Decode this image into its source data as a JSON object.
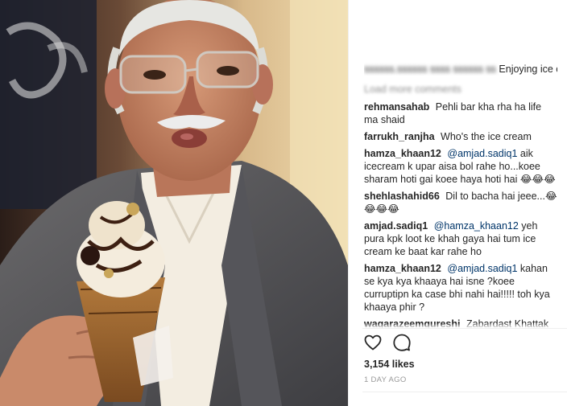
{
  "post": {
    "caption_user": "ssssss.ssssss",
    "caption_text_blurred": "ssss ssssss ss",
    "caption_text": "Enjoying ice cream",
    "load_more": "Load more comments",
    "likes": "3,154 likes",
    "time": "1 DAY AGO"
  },
  "comments": [
    {
      "user": "rehmansahab",
      "mention": "",
      "text": "Pehli bar kha rha ha life ma shaid"
    },
    {
      "user": "farrukh_ranjha",
      "mention": "",
      "text": "Who's the ice cream"
    },
    {
      "user": "hamza_khaan12",
      "mention": "@amjad.sadiq1",
      "text": " aik icecream k upar aisa bol rahe ho...koee sharam hoti gai koee haya hoti hai 😂😂😂"
    },
    {
      "user": "shehlashahid66",
      "mention": "",
      "text": "Dil to bacha hai jeee...😂😂😂😂"
    },
    {
      "user": "amjad.sadiq1",
      "mention": "@hamza_khaan12",
      "text": " yeh pura kpk loot ke khah gaya hai tum ice cream ke baat kar rahe ho"
    },
    {
      "user": "hamza_khaan12",
      "mention": "@amjad.sadiq1",
      "text": " kahan se kya kya khaaya hai isne ?koee curruptipn ka case bhi nahi hai!!!!! toh kya khaaya phir ?"
    },
    {
      "user": "waqarazeemqureshi",
      "mention": "",
      "text": "Zabardast Khattak"
    }
  ],
  "icons": {
    "like": "heart-outline-icon",
    "comment": "speech-bubble-icon"
  },
  "colors": {
    "username": "#262626",
    "mention": "#003569",
    "muted": "#999999",
    "divider": "#efefef"
  }
}
